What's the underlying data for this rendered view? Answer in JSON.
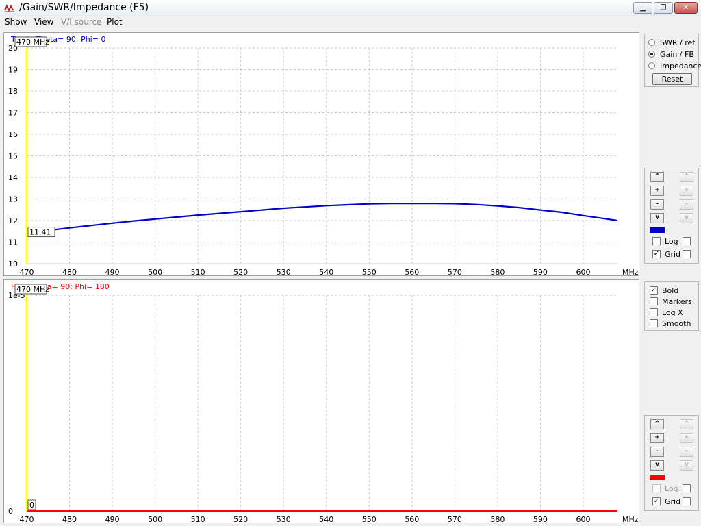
{
  "window": {
    "title": "/Gain/SWR/Impedance (F5)",
    "minimize": "▁",
    "maximize": "❐",
    "close": "✕"
  },
  "menu": {
    "items": [
      {
        "label": "Show",
        "enabled": true
      },
      {
        "label": "View",
        "enabled": true
      },
      {
        "label": "V/I source",
        "enabled": false
      },
      {
        "label": "Plot",
        "enabled": true
      }
    ]
  },
  "plot_top": {
    "header": "Total - Theta= 90; Phi= 0",
    "marker_label": "470 MHz",
    "value_label": "11.41",
    "x_unit": "MHz",
    "color": "#0000c8"
  },
  "plot_bottom": {
    "header": "F/b - Theta= 90; Phi= 180",
    "marker_label": "470 MHz",
    "value_label": "0",
    "x_unit": "MHz",
    "color": "#ff0000"
  },
  "chart_data": [
    {
      "type": "line",
      "title": "Total - Theta= 90; Phi= 0",
      "xlabel": "MHz",
      "xlim": [
        470,
        608
      ],
      "ylim": [
        10,
        20
      ],
      "grid": true,
      "x_ticks": [
        470,
        480,
        490,
        500,
        510,
        520,
        530,
        540,
        550,
        560,
        570,
        580,
        590,
        600
      ],
      "y_ticks": [
        10,
        11,
        12,
        13,
        14,
        15,
        16,
        17,
        18,
        19,
        20
      ],
      "series": [
        {
          "color": "#0000c8",
          "x": [
            470,
            475,
            480,
            485,
            490,
            495,
            500,
            505,
            510,
            515,
            520,
            525,
            530,
            535,
            540,
            545,
            550,
            555,
            560,
            565,
            570,
            575,
            580,
            585,
            590,
            595,
            600,
            605,
            608
          ],
          "y": [
            11.41,
            11.54,
            11.66,
            11.77,
            11.88,
            11.98,
            12.07,
            12.16,
            12.25,
            12.33,
            12.41,
            12.49,
            12.57,
            12.63,
            12.69,
            12.73,
            12.77,
            12.79,
            12.79,
            12.79,
            12.78,
            12.74,
            12.68,
            12.6,
            12.49,
            12.38,
            12.23,
            12.09,
            12.0
          ]
        }
      ],
      "marker": {
        "x": 470,
        "label": "470 MHz",
        "value": "11.41"
      }
    },
    {
      "type": "line",
      "title": "F/b - Theta= 90; Phi= 180",
      "xlabel": "MHz",
      "xlim": [
        470,
        608
      ],
      "ylim": [
        0,
        1
      ],
      "grid": true,
      "x_ticks": [
        470,
        480,
        490,
        500,
        510,
        520,
        530,
        540,
        550,
        560,
        570,
        580,
        590,
        600
      ],
      "y_ticks": [
        "0",
        "1e-5"
      ],
      "series": [
        {
          "color": "#ff0000",
          "x": [
            470,
            608
          ],
          "y": [
            0,
            0
          ]
        }
      ],
      "marker": {
        "x": 470,
        "label": "470 MHz",
        "value": "0"
      }
    }
  ],
  "right_panel": {
    "radios": [
      {
        "label": "SWR / ref",
        "selected": false
      },
      {
        "label": "Gain / FB",
        "selected": true
      },
      {
        "label": "Impedance",
        "selected": false
      }
    ],
    "reset_label": "Reset",
    "scale_buttons": [
      "^",
      "+",
      "-",
      "v"
    ],
    "top_controls": {
      "swatch_color": "#0000c8",
      "log_label": "Log",
      "log_checked": false,
      "grid_label": "Grid",
      "grid_checked": true
    },
    "options": [
      {
        "label": "Bold",
        "checked": true
      },
      {
        "label": "Markers",
        "checked": false
      },
      {
        "label": "Log X",
        "checked": false
      },
      {
        "label": "Smooth",
        "checked": false
      }
    ],
    "bottom_controls": {
      "swatch_color": "#ff0000",
      "log_label": "Log",
      "log_checked": false,
      "grid_label": "Grid",
      "grid_checked": true
    }
  }
}
